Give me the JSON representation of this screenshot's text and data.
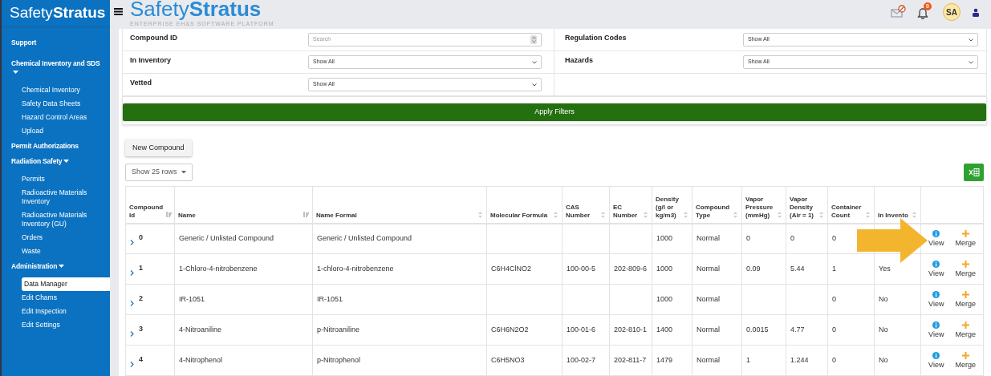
{
  "sidebar": {
    "logo": "Safety**Stratus**",
    "items": [
      {
        "label": "Support"
      },
      {
        "label": "Chemical Inventory and SDS",
        "expanded": true,
        "children": [
          {
            "label": "Chemical Inventory",
            "selected": false
          },
          {
            "label": "Safety Data Sheets",
            "selected": false
          },
          {
            "label": "Hazard Control Areas",
            "selected": false
          },
          {
            "label": "Upload",
            "selected": false
          }
        ]
      },
      {
        "label": "Permit Authorizations"
      },
      {
        "label": "Radiation Safety",
        "expanded": true,
        "children": [
          {
            "label": "Permits",
            "selected": false
          },
          {
            "label": "Radioactive Materials Inventory",
            "selected": false
          },
          {
            "label": "Radioactive Materials Inventory (GU)",
            "selected": false
          },
          {
            "label": "Orders",
            "selected": false
          },
          {
            "label": "Waste",
            "selected": false
          }
        ]
      },
      {
        "label": "Administration",
        "expanded": true,
        "children": [
          {
            "label": "Data Manager",
            "selected": true
          },
          {
            "label": "Edit Chams",
            "selected": false
          },
          {
            "label": "Edit Inspection",
            "selected": false
          },
          {
            "label": "Edit Settings",
            "selected": false
          }
        ]
      }
    ]
  },
  "header": {
    "logo": "Safety**Stratus**",
    "tagline": "ENTERPRISE EH&S SOFTWARE PLATFORM",
    "notification_count": "0",
    "avatar": "SA"
  },
  "filters": [
    {
      "label": "Compound ID",
      "kind": "search",
      "placeholder": "Search"
    },
    {
      "label": "Regulation Codes",
      "kind": "select",
      "value": "Show All"
    },
    {
      "label": "In Inventory",
      "kind": "select",
      "value": "Show All"
    },
    {
      "label": "Hazards",
      "kind": "select",
      "value": "Show All"
    },
    {
      "label": "Vetted",
      "kind": "select",
      "value": "Show All"
    }
  ],
  "apply_button": "Apply Filters",
  "new_button": "New Compound",
  "page_size": "Show 25 rows",
  "table": {
    "columns": [
      {
        "label": "Compound Id",
        "sorted": true
      },
      {
        "label": "Name",
        "sorted": true
      },
      {
        "label": "Name Formal",
        "sorted": false
      },
      {
        "label": "Molecular Formula",
        "sorted": false
      },
      {
        "label": "CAS Number",
        "sorted": false
      },
      {
        "label": "EC Number",
        "sorted": false
      },
      {
        "label": "Density (g/l or kg/m3)",
        "sorted": false
      },
      {
        "label": "Compound Type",
        "sorted": false
      },
      {
        "label": "Vapor Pressure (mmHg)",
        "sorted": false
      },
      {
        "label": "Vapor Density (Air = 1)",
        "sorted": false
      },
      {
        "label": "Container Count",
        "sorted": false
      },
      {
        "label": "In Invento",
        "sorted": false
      }
    ],
    "rows": [
      {
        "cells": [
          "0",
          "Generic / Unlisted Compound",
          "Generic / Unlisted Compound",
          null,
          null,
          null,
          "1000",
          "Normal",
          "0",
          "0",
          "0",
          null
        ],
        "actions": [
          "View",
          "Merge"
        ]
      },
      {
        "cells": [
          "1",
          "1-Chloro-4-nitrobenzene",
          "1-chloro-4-nitrobenzene",
          "C6H4ClNO2",
          "100-00-5",
          "202-809-6",
          "1000",
          "Normal",
          "0.09",
          "5.44",
          "1",
          "Yes"
        ],
        "actions": [
          "View",
          "Merge"
        ]
      },
      {
        "cells": [
          "2",
          "IR-1051",
          "IR-1051",
          null,
          null,
          null,
          "1000",
          "Normal",
          null,
          null,
          "0",
          "No"
        ],
        "actions": [
          "View",
          "Merge"
        ]
      },
      {
        "cells": [
          "3",
          "4-Nitroaniline",
          "p-Nitroaniline",
          "C6H6N2O2",
          "100-01-6",
          "202-810-1",
          "1400",
          "Normal",
          "0.0015",
          "4.77",
          "0",
          "No"
        ],
        "actions": [
          "View",
          "Merge"
        ]
      },
      {
        "cells": [
          "4",
          "4-Nitrophenol",
          "p-Nitrophenol",
          "C6H5NO3",
          "100-02-7",
          "202-811-7",
          "1479",
          "Normal",
          "1",
          "1.244",
          "0",
          "No"
        ],
        "actions": [
          "View",
          "Merge"
        ]
      }
    ]
  }
}
